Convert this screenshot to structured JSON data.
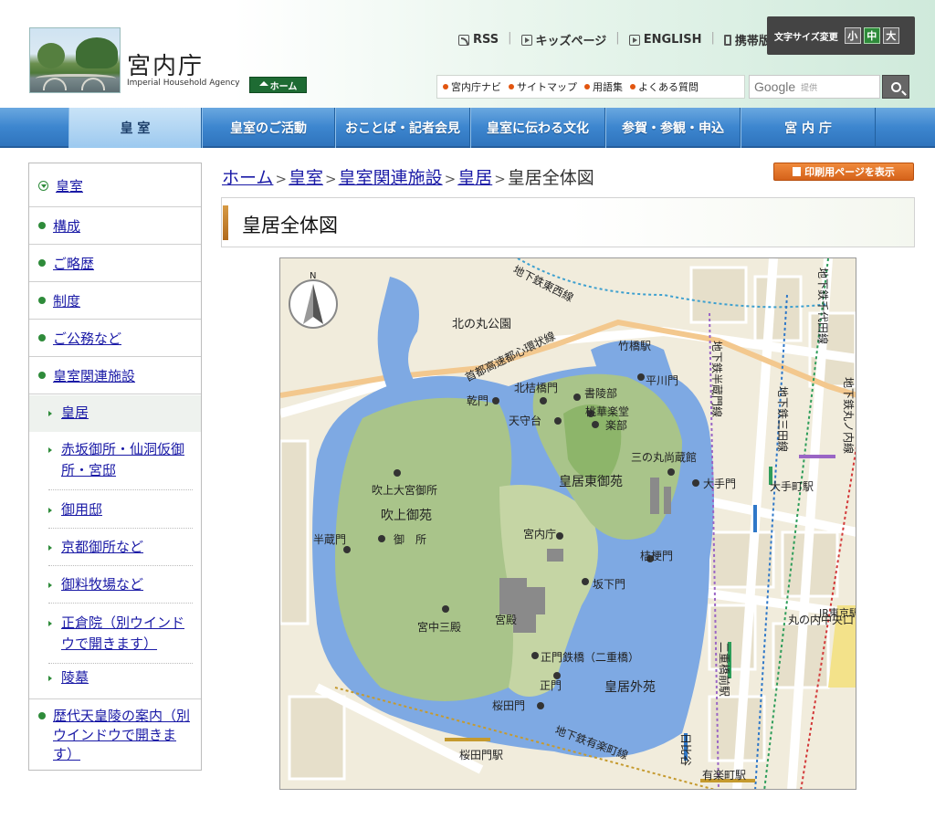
{
  "header": {
    "site_name": "宮内庁",
    "site_name_en": "Imperial Household Agency",
    "home_label": "ホーム",
    "top_links": [
      "RSS",
      "キッズページ",
      "ENGLISH",
      "携帯版"
    ],
    "font_size_label": "文字サイズ変更",
    "font_sizes": [
      "小",
      "中",
      "大"
    ],
    "sub_links": [
      "宮内庁ナビ",
      "サイトマップ",
      "用語集",
      "よくある質問"
    ],
    "search_brand": "Google",
    "search_sub": "提供"
  },
  "nav": {
    "items": [
      "皇 室",
      "皇室のご活動",
      "おことば・記者会見",
      "皇室に伝わる文化",
      "参賀・参観・申込",
      "宮 内 庁"
    ]
  },
  "sidebar": {
    "top": "皇室",
    "items": [
      "構成",
      "ご略歴",
      "制度",
      "ご公務など",
      "皇室関連施設"
    ],
    "sub_items": [
      "皇居",
      "赤坂御所・仙洞仮御所・宮邸",
      "御用邸",
      "京都御所など",
      "御料牧場など",
      "正倉院（別ウインドウで開きます）",
      "陵墓"
    ],
    "bottom": "歴代天皇陵の案内（別ウインドウで開きます）"
  },
  "breadcrumb": {
    "items": [
      "ホーム",
      "皇室",
      "皇室関連施設",
      "皇居"
    ],
    "current": "皇居全体図"
  },
  "print_label": "印刷用ページを表示",
  "page_title": "皇居全体図",
  "map": {
    "north": "N",
    "labels": {
      "kitanomaru": "北の丸公園",
      "expressway": "首都高速都心環状線",
      "tozai": "地下鉄東西線",
      "chiyoda": "地下鉄千代田線",
      "hanzomon_line": "地下鉄半蔵門線",
      "mita": "地下鉄三田線",
      "marunouchi": "地下鉄丸ノ内線",
      "yurakucho_line": "地下鉄有楽町線",
      "hibiya": "日比谷",
      "takebashi_st": "竹橋駅",
      "otemachi_st": "大手町駅",
      "nijubashimae_st": "二重橋前駅",
      "sakuradamon_st": "桜田門駅",
      "yurakucho_st": "有楽町駅",
      "tokyo_st": "JR東京駅",
      "marunouchi_central": "丸の内中央口",
      "hirakawamon": "平川門",
      "kitahanebashimon": "北桔橋門",
      "shoryobu": "書陵部",
      "tokagakudo": "桃華楽堂",
      "gakubu": "楽部",
      "inuimon": "乾門",
      "tenshudai": "天守台",
      "sannomaru": "三の丸尚蔵館",
      "otemon": "大手門",
      "kokyo_higashi_gyoen": "皇居東御苑",
      "fukiage_omiya": "吹上大宮御所",
      "fukiage_gyoen": "吹上御苑",
      "gosho": "御　所",
      "hanzomon": "半蔵門",
      "kunaicho": "宮内庁",
      "kikyomon": "桔梗門",
      "sakashitamon": "坂下門",
      "kyuchu_sanden": "宮中三殿",
      "kyuden": "宮殿",
      "seimon_tetsubashi": "正門鉄橋（二重橋）",
      "seimon": "正門",
      "kokyo_gaien": "皇居外苑",
      "sakuradamon": "桜田門"
    }
  },
  "colors": {
    "nav_blue": "#3d86cf",
    "accent_green": "#2e8b3a",
    "link_blue": "#1a1aa6",
    "print_orange": "#e2731f",
    "moat": "#7ea9e3",
    "garden": "#a9c48a"
  }
}
